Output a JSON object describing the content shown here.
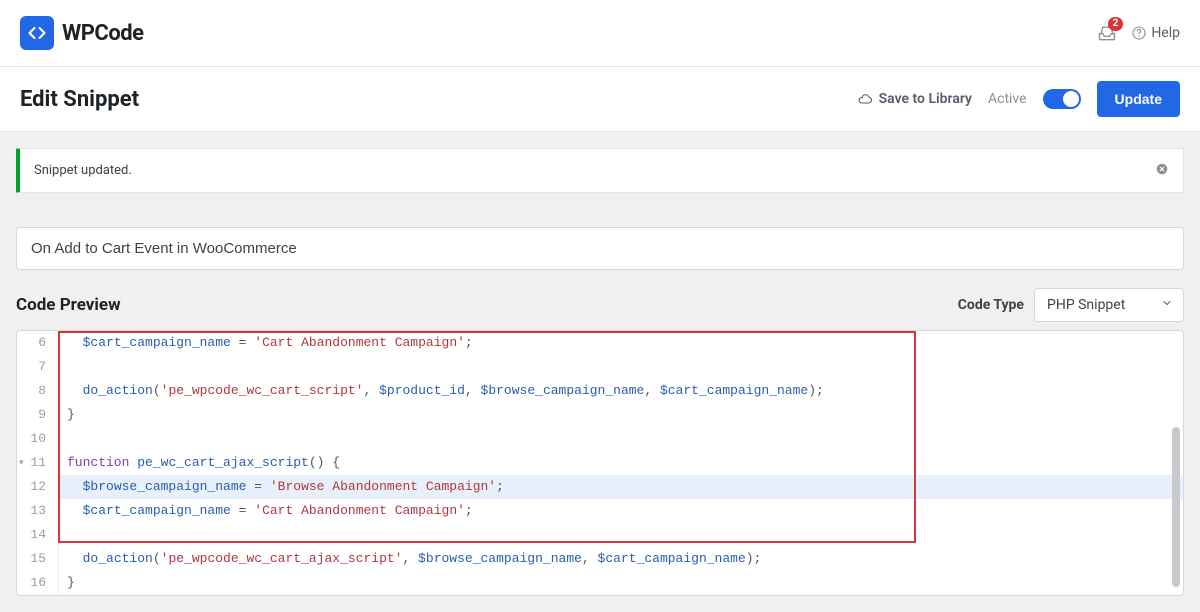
{
  "header": {
    "brand": "WPCode",
    "notif_count": "2",
    "help_label": "Help"
  },
  "titlebar": {
    "page_title": "Edit Snippet",
    "save_library": "Save to Library",
    "active_label": "Active",
    "update_btn": "Update"
  },
  "notice": {
    "text": "Snippet updated."
  },
  "snippet": {
    "title": "On Add to Cart Event in WooCommerce"
  },
  "preview": {
    "heading": "Code Preview",
    "code_type_label": "Code Type",
    "code_type_value": "PHP Snippet"
  },
  "code": {
    "lines": [
      {
        "n": "6",
        "indent": "  ",
        "tokens": [
          [
            "var",
            "$cart_campaign_name"
          ],
          [
            "pl",
            " "
          ],
          [
            "op",
            "="
          ],
          [
            "pl",
            " "
          ],
          [
            "str",
            "'Cart Abandonment Campaign'"
          ],
          [
            "pl",
            ";"
          ]
        ]
      },
      {
        "n": "7",
        "indent": "",
        "tokens": []
      },
      {
        "n": "8",
        "indent": "  ",
        "tokens": [
          [
            "fn",
            "do_action"
          ],
          [
            "pl",
            "("
          ],
          [
            "str",
            "'pe_wpcode_wc_cart_script'"
          ],
          [
            "pl",
            ", "
          ],
          [
            "var",
            "$product_id"
          ],
          [
            "pl",
            ", "
          ],
          [
            "var",
            "$browse_campaign_name"
          ],
          [
            "pl",
            ", "
          ],
          [
            "var",
            "$cart_campaign_name"
          ],
          [
            "pl",
            ");"
          ]
        ]
      },
      {
        "n": "9",
        "indent": "",
        "tokens": [
          [
            "pl",
            "}"
          ]
        ]
      },
      {
        "n": "10",
        "indent": "",
        "tokens": []
      },
      {
        "n": "11",
        "indent": "",
        "fold": true,
        "tokens": [
          [
            "kw",
            "function"
          ],
          [
            "pl",
            " "
          ],
          [
            "fn",
            "pe_wc_cart_ajax_script"
          ],
          [
            "pl",
            "() {"
          ]
        ]
      },
      {
        "n": "12",
        "hl": true,
        "indent": "  ",
        "tokens": [
          [
            "var",
            "$browse_campaign_name"
          ],
          [
            "pl",
            " "
          ],
          [
            "op",
            "="
          ],
          [
            "pl",
            " "
          ],
          [
            "str",
            "'Browse Abandonment Campaign'"
          ],
          [
            "pl",
            ";"
          ]
        ]
      },
      {
        "n": "13",
        "indent": "  ",
        "tokens": [
          [
            "var",
            "$cart_campaign_name"
          ],
          [
            "pl",
            " "
          ],
          [
            "op",
            "="
          ],
          [
            "pl",
            " "
          ],
          [
            "str",
            "'Cart Abandonment Campaign'"
          ],
          [
            "pl",
            ";"
          ]
        ]
      },
      {
        "n": "14",
        "indent": "",
        "tokens": []
      },
      {
        "n": "15",
        "indent": "  ",
        "tokens": [
          [
            "fn",
            "do_action"
          ],
          [
            "pl",
            "("
          ],
          [
            "str",
            "'pe_wpcode_wc_cart_ajax_script'"
          ],
          [
            "pl",
            ", "
          ],
          [
            "var",
            "$browse_campaign_name"
          ],
          [
            "pl",
            ", "
          ],
          [
            "var",
            "$cart_campaign_name"
          ],
          [
            "pl",
            ");"
          ]
        ]
      },
      {
        "n": "16",
        "indent": "",
        "tokens": [
          [
            "pl",
            "}"
          ]
        ]
      }
    ]
  }
}
